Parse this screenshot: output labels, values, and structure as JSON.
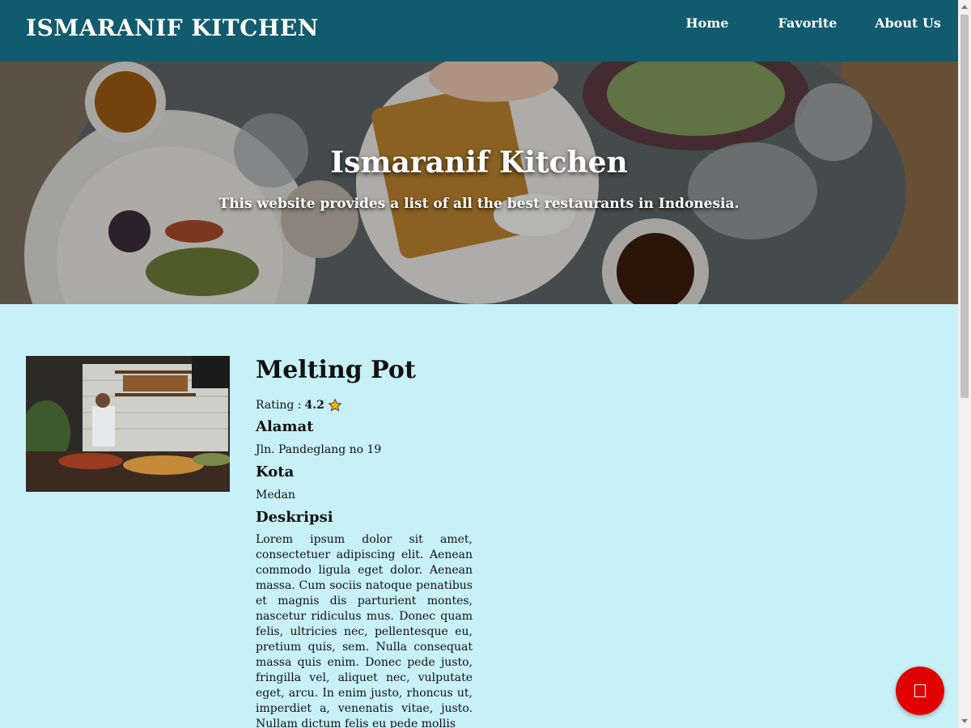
{
  "header": {
    "brand": "ISMARANIF KITCHEN",
    "nav": [
      "Home",
      "Favorite",
      "About Us"
    ]
  },
  "hero": {
    "title": "Ismaranif Kitchen",
    "subtitle": "This website provides a list of all the best restaurants in Indonesia."
  },
  "restaurant": {
    "name": "Melting Pot",
    "rating_label": "Rating : ",
    "rating_value": "4.2",
    "address_label": "Alamat",
    "address": "Jln. Pandeglang no 19",
    "city_label": "Kota",
    "city": "Medan",
    "description_label": "Deskripsi",
    "description": "Lorem ipsum dolor sit amet, consectetuer adipiscing elit. Aenean commodo ligula eget dolor. Aenean massa. Cum sociis natoque penatibus et magnis dis parturient montes, nascetur ridiculus mus. Donec quam felis, ultricies nec, pellentesque eu, pretium quis, sem. Nulla consequat massa quis enim. Donec pede justo, fringilla vel, aliquet nec, vulputate eget, arcu. In enim justo, rhoncus ut, imperdiet a, venenatis vitae, justo. Nullam dictum felis eu pede mollis"
  },
  "icons": {
    "rating": "star-icon",
    "fab": "favorite-square-icon"
  },
  "colors": {
    "header_bg": "#115b6e",
    "page_bg": "#c7f0f7",
    "fab_bg": "#e00000",
    "star": "#f2b705"
  }
}
